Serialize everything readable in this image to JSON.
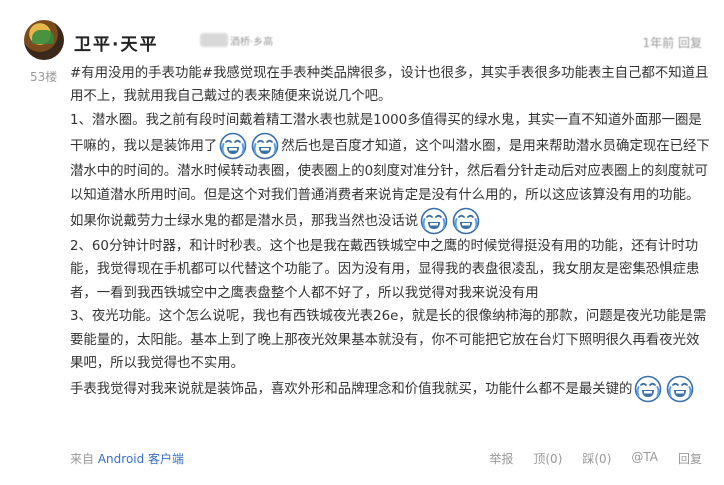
{
  "user": {
    "name": "卫平·天平",
    "level_badge": "酒桥·乡高",
    "meta": "1年前 回复"
  },
  "post": {
    "floor": "53楼",
    "paragraphs": [
      [
        "#有用没用的手表功能#我感觉现在手表种类品牌很多，设计也很多，其实手表很多功能表主自己都不知道且用不上，我就用我自己戴过的表来随便来说说几个吧。"
      ],
      [
        "1、潜水圈。我之前有段时间戴着精工潜水表也就是1000多值得买的绿水鬼，其实一直不知道外面那一圈是干嘛的，我以是装饰用了",
        "EMOJI",
        "EMOJI",
        "然后也是百度才知道，这个叫潜水圈，是用来帮助潜水员确定现在已经下潜水中的时间的。潜水时候转动表圈，使表圈上的0刻度对准分针，然后看分针走动后对应表圈上的刻度就可以知道潜水所用时间。但是这个对我们普通消费者来说肯定是没有什么用的，所以这应该算没有用的功能。如果你说戴劳力士绿水鬼的都是潜水员，那我当然也没话说",
        "EMOJI",
        "EMOJI"
      ],
      [
        "2、60分钟计时器，和计时秒表。这个也是我在戴西铁城空中之鹰的时候觉得挺没有用的功能，还有计时功能，我觉得现在手机都可以代替这个功能了。因为没有用，显得我的表盘很凌乱，我女朋友是密集恐惧症患者，一看到我西铁城空中之鹰表盘整个人都不好了，所以我觉得对我来说没有用"
      ],
      [
        "3、夜光功能。这个怎么说呢，我也有西铁城夜光表26e，就是长的很像纳柿海的那款，问题是夜光功能是需要能量的，太阳能。基本上到了晚上那夜光效果基本就没有，你不可能把它放在台灯下照明很久再看夜光效果吧，所以我觉得也不实用。"
      ],
      [
        "手表我觉得对我来说就是装饰品，喜欢外形和品牌理念和价值我就买，功能什么都不是最关键的",
        "EMOJI",
        "EMOJI"
      ]
    ],
    "emoji_icon": "laughing-crying-face"
  },
  "footer": {
    "source_prefix": "来自",
    "source_app": "Android 客户端",
    "actions": {
      "report": "举报",
      "page_up": "顶(0)",
      "page_down": "踩(0)",
      "at": "@TA",
      "reply": "回复"
    }
  }
}
